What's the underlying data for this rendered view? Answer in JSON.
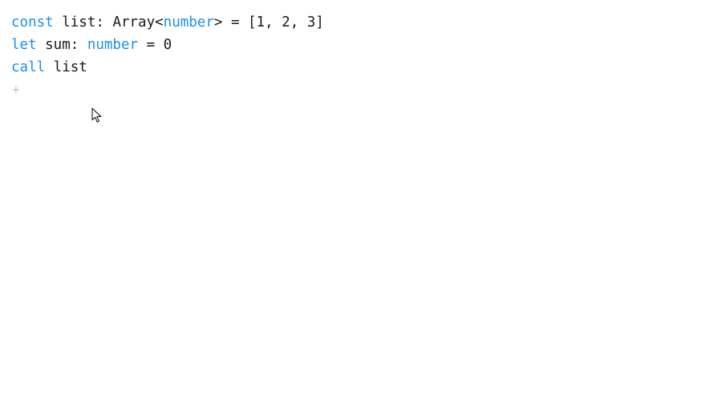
{
  "lines": [
    {
      "tokens": [
        {
          "text": "const",
          "kind": "keyword"
        },
        {
          "text": " list: Array<",
          "kind": "plain"
        },
        {
          "text": "number",
          "kind": "type"
        },
        {
          "text": "> = [1, 2, 3]",
          "kind": "plain"
        }
      ]
    },
    {
      "tokens": [
        {
          "text": "let",
          "kind": "keyword"
        },
        {
          "text": " sum: ",
          "kind": "plain"
        },
        {
          "text": "number",
          "kind": "type"
        },
        {
          "text": " = 0",
          "kind": "plain"
        }
      ]
    },
    {
      "tokens": [
        {
          "text": "call",
          "kind": "keyword"
        },
        {
          "text": " list",
          "kind": "plain"
        }
      ]
    }
  ],
  "add_line": {
    "label": "+"
  },
  "colors": {
    "keyword": "#1f8fe6",
    "type": "#1f8fe6",
    "plain": "#1a1a1a",
    "add_line": "#c4c4c4",
    "background": "#ffffff"
  },
  "icons": {
    "mouse_cursor": "arrow-pointer-icon"
  }
}
